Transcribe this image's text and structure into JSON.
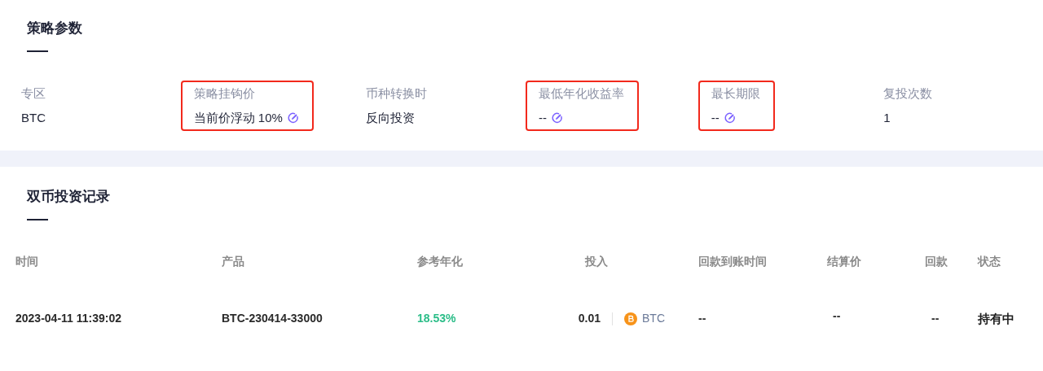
{
  "strategy": {
    "title": "策略参数",
    "params": [
      {
        "label": "专区",
        "value": "BTC",
        "editable": false,
        "highlighted": false
      },
      {
        "label": "策略挂钩价",
        "value": "当前价浮动 10%",
        "editable": true,
        "highlighted": true
      },
      {
        "label": "币种转换时",
        "value": "反向投资",
        "editable": false,
        "highlighted": false
      },
      {
        "label": "最低年化收益率",
        "value": "--",
        "editable": true,
        "highlighted": true
      },
      {
        "label": "最长期限",
        "value": "--",
        "editable": true,
        "highlighted": true
      },
      {
        "label": "复投次数",
        "value": "1",
        "editable": false,
        "highlighted": false
      }
    ]
  },
  "records": {
    "title": "双币投资记录",
    "columns": [
      "时间",
      "产品",
      "参考年化",
      "投入",
      "回款到账时间",
      "结算价",
      "回款",
      "状态"
    ],
    "rows": [
      {
        "time": "2023-04-11 11:39:02",
        "product": "BTC-230414-33000",
        "apy": "18.53%",
        "amount": "0.01",
        "coin": "BTC",
        "payout_time": "--",
        "settle_price": "--",
        "payout": "--",
        "status": "持有中"
      }
    ]
  }
}
